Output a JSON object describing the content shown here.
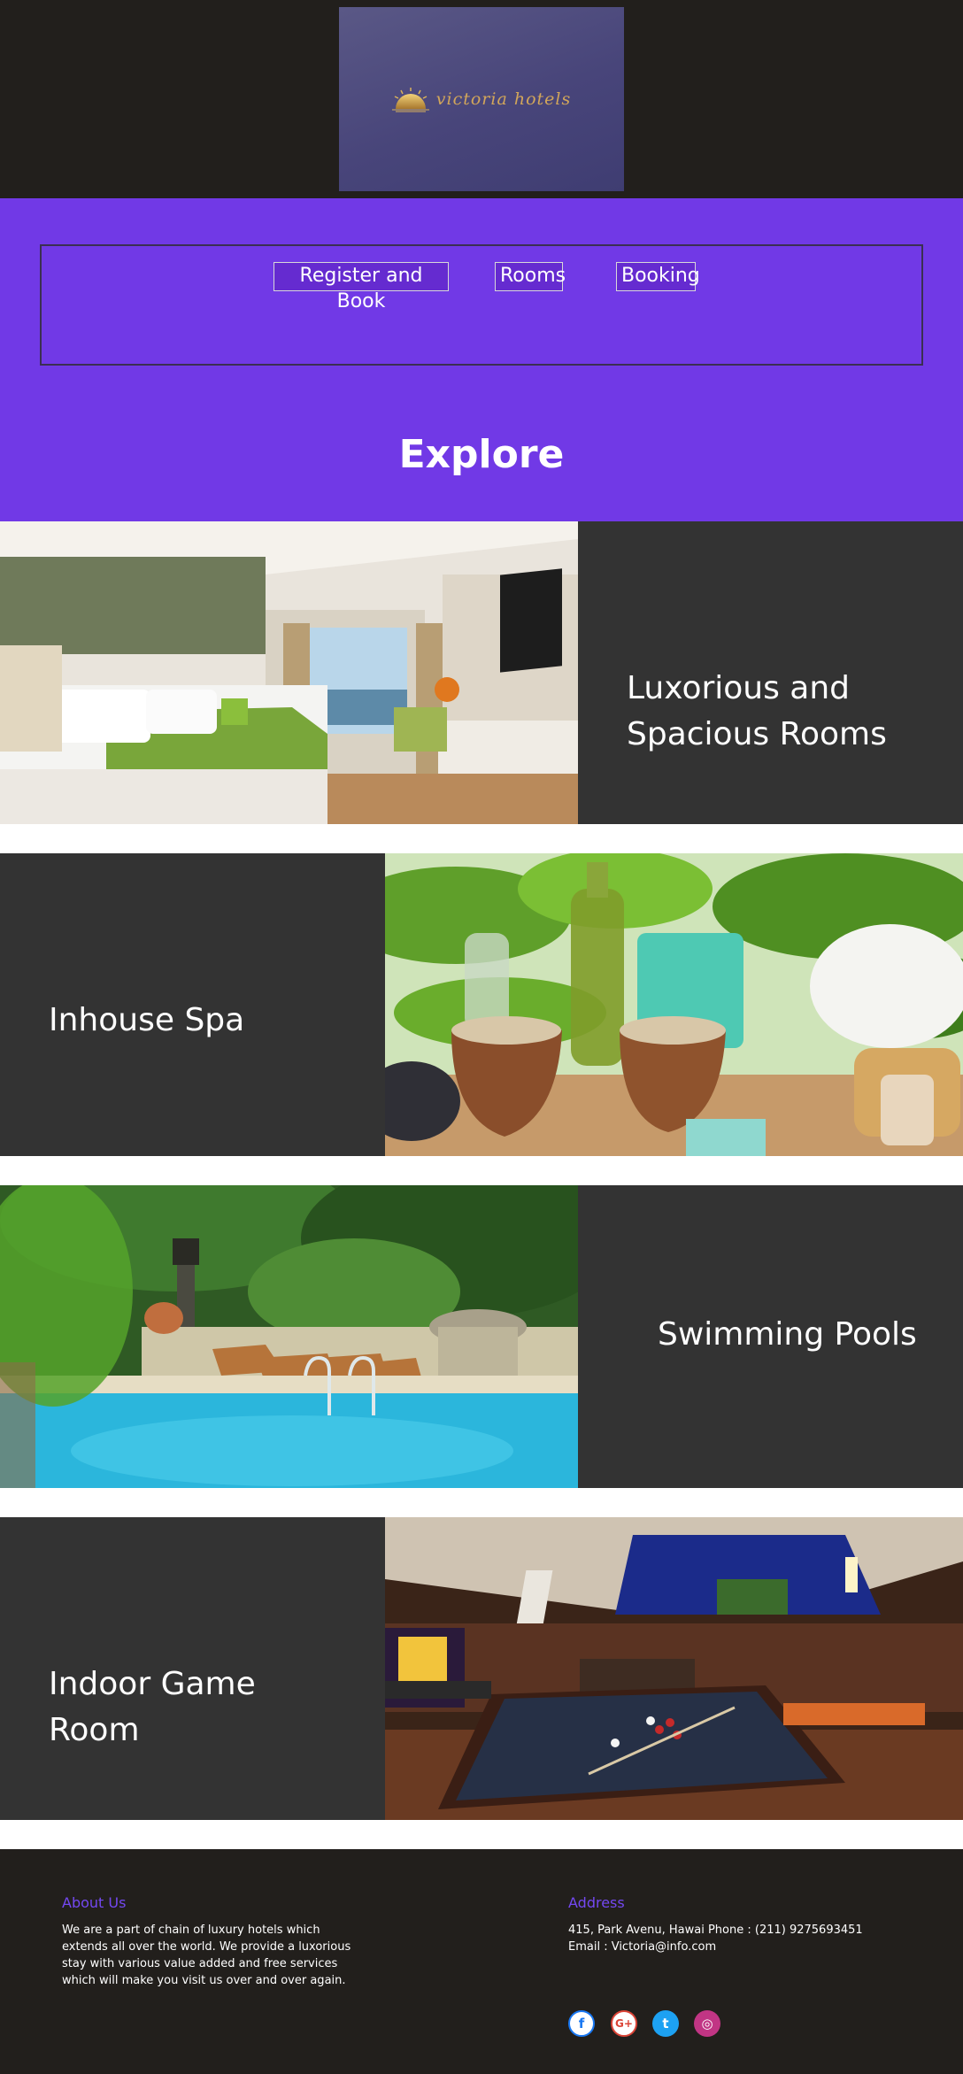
{
  "header": {
    "logo_text": "victoria hotels"
  },
  "nav": {
    "links": [
      {
        "label": "Register and Book"
      },
      {
        "label": "Rooms"
      },
      {
        "label": "Booking"
      }
    ]
  },
  "hero": {
    "title": "Explore"
  },
  "features": [
    {
      "title": "Luxorious and Spacious Rooms",
      "image": "hotel-bedroom-photo"
    },
    {
      "title": "Inhouse Spa",
      "image": "spa-bowls-photo"
    },
    {
      "title": "Swimming Pools",
      "image": "swimming-pool-photo"
    },
    {
      "title": "Indoor Game Room",
      "image": "game-room-photo"
    }
  ],
  "footer": {
    "about": {
      "heading": "About Us",
      "lines": [
        "We are a part of chain of luxury hotels which",
        "extends all over the world. We provide a luxorious",
        "stay with various value added and free services",
        "which will make you visit us over and over again."
      ]
    },
    "address": {
      "heading": "Address",
      "line1": "415, Park Avenu, Hawai Phone : (211) 9275693451",
      "line2": "Email : Victoria@info.com"
    },
    "social": [
      {
        "icon": "facebook-icon",
        "glyph": "f",
        "color": "#1877f2"
      },
      {
        "icon": "google-plus-icon",
        "glyph": "G+",
        "color": "#db4437"
      },
      {
        "icon": "twitter-icon",
        "glyph": "t",
        "color": "#1da1f2"
      },
      {
        "icon": "instagram-icon",
        "glyph": "◎",
        "color": "#c13584"
      }
    ]
  },
  "colors": {
    "header_bg": "#221f1c",
    "nav_bg": "#7139e6",
    "panel_bg": "#333333",
    "footer_heading": "#7448f2"
  }
}
